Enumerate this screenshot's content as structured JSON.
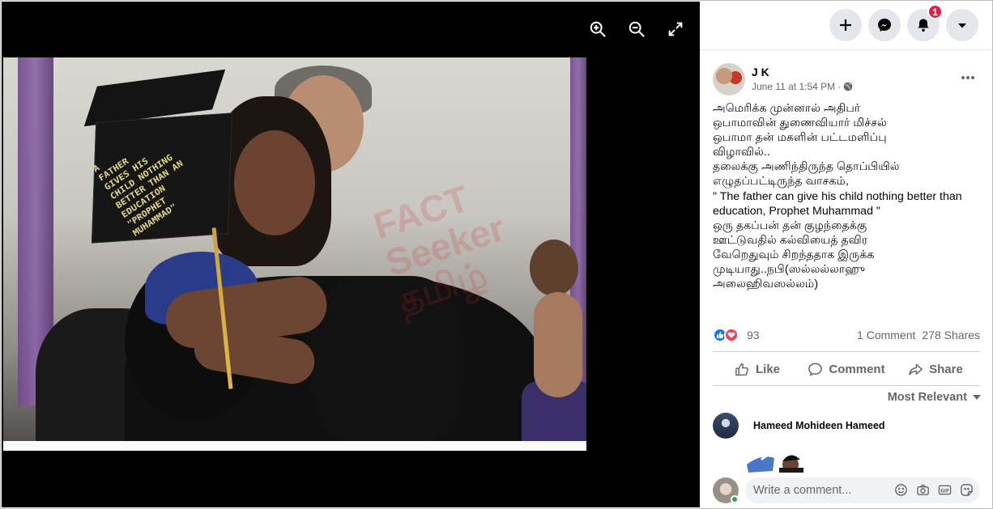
{
  "viewer": {
    "controls": [
      {
        "name": "zoom-in-icon"
      },
      {
        "name": "zoom-out-icon"
      },
      {
        "name": "fullscreen-icon"
      }
    ],
    "photo": {
      "cap_lines": [
        "A",
        "FATHER",
        "GIVES HIS",
        "CHILD NOTHING",
        "BETTER THAN AN",
        "EDUCATION",
        "\"PROPHET",
        "MUHAMMAD\""
      ],
      "watermark_lines": [
        "FACT",
        "Seeker",
        "தமிழ்"
      ]
    }
  },
  "topbar": {
    "buttons": [
      {
        "name": "create-button",
        "icon": "plus-icon"
      },
      {
        "name": "messenger-button",
        "icon": "messenger-icon"
      },
      {
        "name": "notifications-button",
        "icon": "bell-icon",
        "badge": "1"
      },
      {
        "name": "account-button",
        "icon": "caret-down-icon"
      }
    ],
    "bg_color": "#e4e6eb",
    "badge_color": "#e41e3f"
  },
  "post": {
    "author": "J K",
    "timestamp": "June 11 at 1:54 PM",
    "separator": "·",
    "audience_icon": "globe-icon",
    "lines": [
      "அமெரிக்க முன்னால் அதிபர்",
      "ஒபாமாவின் துணைவியார் மிச்சல்",
      "ஒபாமா தன் மகளின் பட்டமளிப்பு",
      "விழாவில்..",
      "தலைக்கு அணிந்திருந்த தொப்பியில்",
      "எழுதப்பட்டிருந்த வாசகம்,",
      "\" The father can give his child nothing better than",
      "education, Prophet Muhammad \"",
      "ஒரு தகப்பன் தன் குழந்தைக்கு",
      "ஊட்டுவதில் கல்வியைத் தவிர",
      "வேறெதுவும் சிறந்ததாக இருக்க",
      "முடியாது..நபி(ஸல்லல்லாஹு",
      "அலைஹிவஸல்லம்)"
    ],
    "reactions_count": "93",
    "comments_count": "1 Comment",
    "shares_count": "278 Shares"
  },
  "actions": {
    "like": "Like",
    "comment": "Comment",
    "share": "Share"
  },
  "comments": {
    "sort_label": "Most Relevant",
    "items": [
      {
        "name": "Hameed Mohideen Hameed"
      }
    ],
    "composer_placeholder": "Write a comment...",
    "composer_tools": [
      "emoji-icon",
      "camera-icon",
      "gif-icon",
      "sticker-icon"
    ]
  }
}
